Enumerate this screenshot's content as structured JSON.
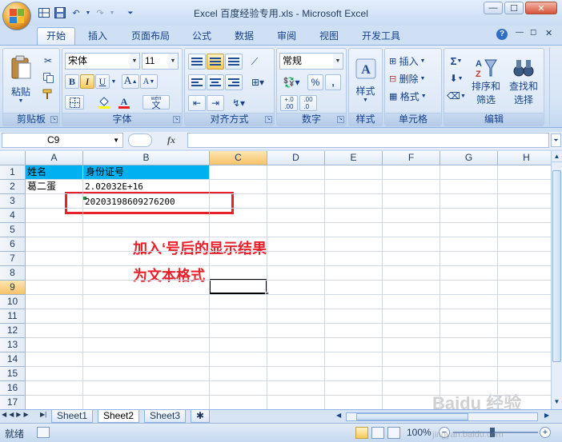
{
  "window": {
    "title": "Excel 百度经验专用.xls - Microsoft Excel",
    "controls": [
      "—",
      "☐",
      "✕"
    ]
  },
  "ribbon_tabs": [
    "开始",
    "插入",
    "页面布局",
    "公式",
    "数据",
    "审阅",
    "视图",
    "开发工具"
  ],
  "ribbon": {
    "clipboard": {
      "label": "剪贴板",
      "paste": "粘贴"
    },
    "font": {
      "label": "字体",
      "font_name": "宋体",
      "font_size": "11",
      "bold": "B",
      "italic": "I",
      "underline": "U",
      "grow": "A",
      "shrink": "A",
      "font_color": "A",
      "wen": "wén",
      "wen_char": "文"
    },
    "alignment": {
      "label": "对齐方式"
    },
    "number": {
      "label": "数字",
      "format": "常规",
      "percent": "%",
      "comma": ",",
      "inc": "←.0 .00",
      "dec": ".00 →.0"
    },
    "styles": {
      "label": "样式",
      "button": "样式"
    },
    "cells": {
      "label": "单元格",
      "insert": "插入",
      "delete": "删除",
      "format": "格式"
    },
    "editing": {
      "label": "编辑",
      "sigma": "Σ",
      "sort": "排序和\n筛选",
      "sort_line1": "排序和",
      "sort_line2": "筛选",
      "find_line1": "查找和",
      "find_line2": "选择"
    }
  },
  "formula_bar": {
    "name_box": "C9",
    "fx": "fx",
    "formula": ""
  },
  "grid": {
    "columns": [
      "A",
      "B",
      "C",
      "D",
      "E",
      "F",
      "G",
      "H"
    ],
    "rows": [
      "1",
      "2",
      "3",
      "4",
      "5",
      "6",
      "7",
      "8",
      "9",
      "10",
      "11",
      "12",
      "13",
      "14",
      "15",
      "16",
      "17"
    ],
    "selected_cell": "C9",
    "cells": {
      "A1": "姓名",
      "B1": "身份证号",
      "A2": "葛二蛋",
      "B2": "2.02032E+16",
      "B3": "20203198609276200"
    },
    "header_fill_color": "#00b0f0"
  },
  "annotation": {
    "line1": "加入‘号后的显示结果",
    "line2": "为文本格式",
    "color": "#e8202a"
  },
  "sheet_tabs": [
    "Sheet1",
    "Sheet2",
    "Sheet3"
  ],
  "active_sheet": "Sheet2",
  "status": {
    "ready": "就绪",
    "zoom": "100%"
  },
  "watermark": {
    "brand": "Baidu 经验",
    "url": "jingyan.baidu.com"
  }
}
